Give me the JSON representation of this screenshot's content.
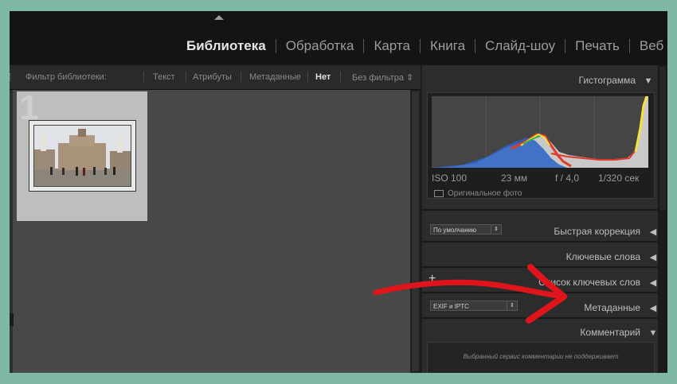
{
  "modules": [
    "Библиотека",
    "Обработка",
    "Карта",
    "Книга",
    "Слайд-шоу",
    "Печать",
    "Веб"
  ],
  "active_module": "Библиотека",
  "filter_bar": {
    "label": "Фильтр библиотеки:",
    "options": [
      "Текст",
      "Атрибуты",
      "Метаданные",
      "Нет"
    ],
    "selected": "Нет",
    "preset": "Без фильтра ⇕"
  },
  "grid": {
    "cell_number": "1"
  },
  "histogram": {
    "title": "Гистограмма",
    "iso": "ISO 100",
    "focal": "23 мм",
    "aperture": "f / 4,0",
    "shutter": "1/320 сек",
    "original_photo": "Оригинальное фото"
  },
  "panels": {
    "quick_develop": "Быстрая коррекция",
    "quick_preset": "По умолчанию",
    "keywording": "Ключевые слова",
    "keyword_list": "Список ключевых слов",
    "metadata": "Метаданные",
    "metadata_preset": "EXIF и IPTC",
    "comments": "Комментарий",
    "comments_note": "Выбранный сервис комментарии не поддерживает"
  },
  "colors": {
    "background": "#7fb8a3",
    "annotation_arrow": "#e0151c"
  }
}
